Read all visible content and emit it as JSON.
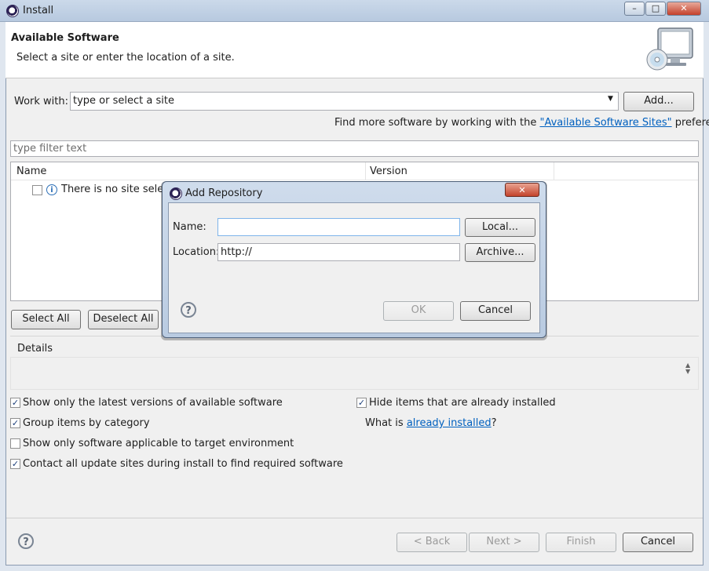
{
  "window": {
    "title": "Install",
    "min_label": "–",
    "max_label": "□",
    "close_label": "✕"
  },
  "banner": {
    "title": "Available Software",
    "description": "Select a site or enter the location of a site.",
    "icon": "monitor-cd-icon"
  },
  "work_with": {
    "label": "Work with:",
    "placeholder": "type or select a site",
    "add_label": "Add..."
  },
  "find_more": {
    "prefix": "Find more software by working with the ",
    "link": "\"Available Software Sites\"",
    "suffix": " preferences."
  },
  "filter": {
    "placeholder": "type filter text"
  },
  "table": {
    "columns": [
      "Name",
      "Version"
    ],
    "empty_row": "There is no site selecte"
  },
  "buttons": {
    "select_all": "Select All",
    "deselect_all": "Deselect All"
  },
  "details": {
    "label": "Details"
  },
  "options": {
    "latest_versions": {
      "label": "Show only the latest versions of available software",
      "checked": true
    },
    "group_by_category": {
      "label": "Group items by category",
      "checked": true
    },
    "applicable_only": {
      "label": "Show only software applicable to target environment",
      "checked": false
    },
    "contact_all_sites": {
      "label": "Contact all update sites during install to find required software",
      "checked": true
    },
    "hide_installed": {
      "label": "Hide items that are already installed",
      "checked": true
    },
    "what_is": {
      "prefix": "What is ",
      "link": "already installed",
      "suffix": "?"
    }
  },
  "footer": {
    "back": "< Back",
    "next": "Next >",
    "finish": "Finish",
    "cancel": "Cancel",
    "help": "?"
  },
  "dialog": {
    "title": "Add Repository",
    "close_label": "✕",
    "name_label": "Name:",
    "name_value": "",
    "location_label": "Location:",
    "location_value": "http://",
    "local_label": "Local...",
    "archive_label": "Archive...",
    "ok_label": "OK",
    "cancel_label": "Cancel",
    "help": "?"
  }
}
